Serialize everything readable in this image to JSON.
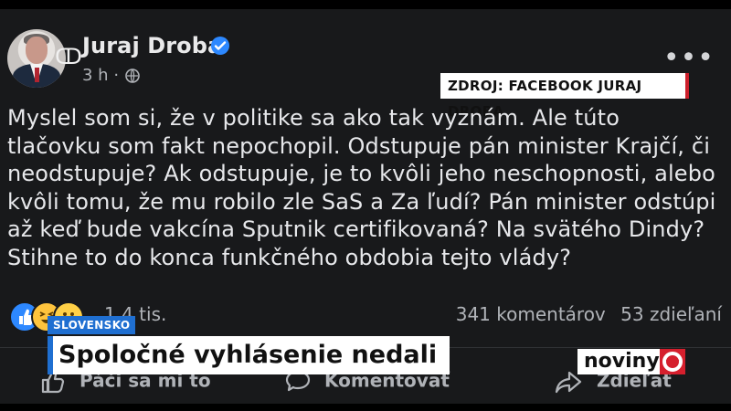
{
  "post": {
    "author": "Juraj Droba",
    "time": "3 h",
    "separator": "·",
    "text": "Myslel som si, že v politike sa ako tak vyznám. Ale túto tlačovku som fakt nepochopil. Odstupuje pán minister Krajčí, či neodstupuje? Ak odstupuje, je to kvôli jeho neschopnosti, alebo kvôli tomu, že mu robilo zle SaS a Za ľudí? Pán minister odstúpi až keď bude vakcína Sputnik certifikovaná? Na svätého Dindy? Stihne to do konca funkčného obdobia tejto vlády?",
    "reaction_count": "1,4 tis.",
    "comments": "341 komentárov",
    "shares": "53 zdieľaní"
  },
  "overlay": {
    "source": "ZDROJ: FACEBOOK JURAJ DROBA",
    "category": "SLOVENSKO",
    "headline": "Spoločné vyhlásenie nedali",
    "brand": "noviny"
  },
  "actions": {
    "like": "Páči sa mi to",
    "comment": "Komentovať",
    "share": "Zdieľať"
  },
  "icons": {
    "verified": "verified-check-icon",
    "globe": "globe-icon",
    "more": "more-options-icon",
    "reactions": [
      "like-reaction-icon",
      "haha-reaction-icon",
      "wow-reaction-icon"
    ]
  },
  "colors": {
    "background": "#18191b",
    "accent": "#2d88ff",
    "brand_red": "#d51f2d"
  }
}
